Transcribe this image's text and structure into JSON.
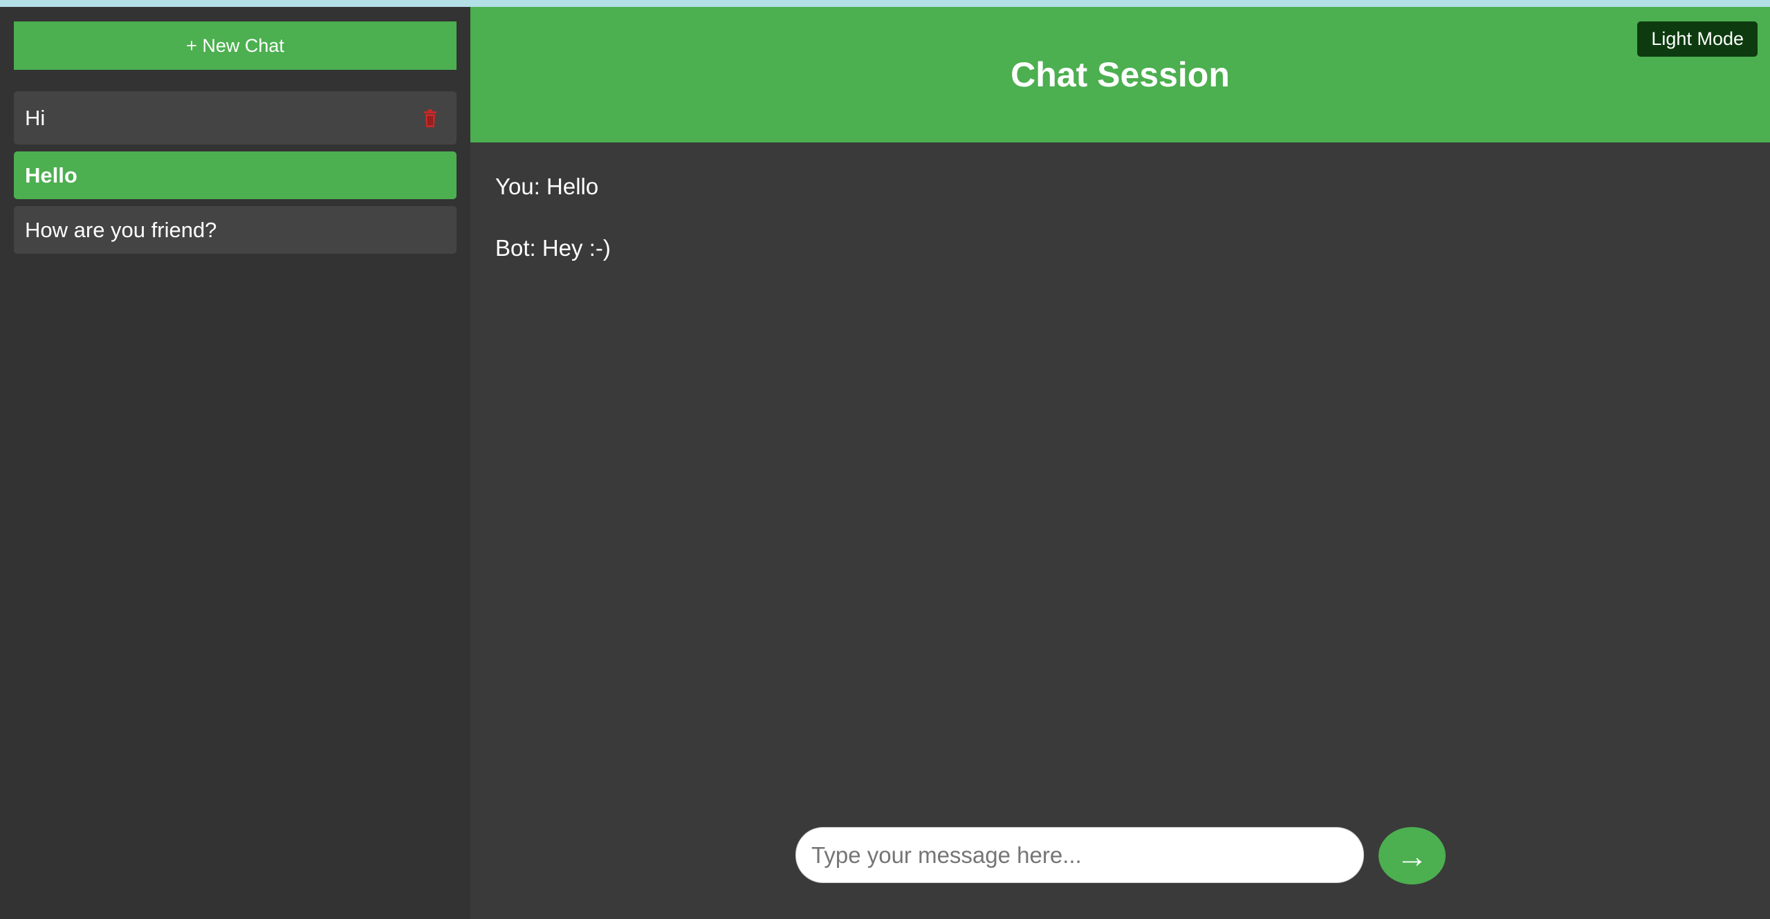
{
  "sidebar": {
    "new_chat_label": "+ New Chat",
    "items": [
      {
        "label": "Hi",
        "active": false,
        "has_delete": true
      },
      {
        "label": "Hello",
        "active": true,
        "has_delete": false
      },
      {
        "label": "How are you friend?",
        "active": false,
        "has_delete": false
      }
    ]
  },
  "header": {
    "title": "Chat Session",
    "mode_toggle_label": "Light Mode"
  },
  "messages": [
    {
      "text": "You: Hello"
    },
    {
      "text": "Bot: Hey :-)"
    }
  ],
  "composer": {
    "placeholder": "Type your message here...",
    "value": "",
    "send_icon": "arrow-right-icon",
    "send_glyph": "→"
  },
  "colors": {
    "accent": "#4caf50",
    "sidebar_bg": "#333333",
    "main_bg": "#3a3a3a",
    "item_bg": "#444444",
    "mode_button_bg": "#0d3b0f",
    "delete_icon": "#c62828",
    "top_strip": "#b3dfe6"
  }
}
